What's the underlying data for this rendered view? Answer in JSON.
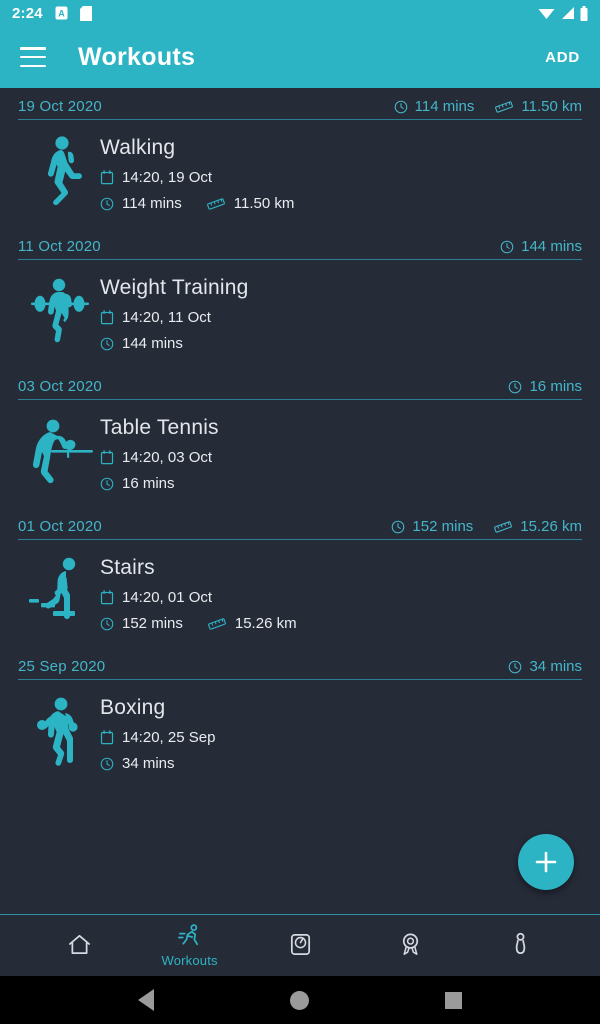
{
  "status_bar": {
    "time": "2:24",
    "left_icons": [
      "alert-badge-icon",
      "sdcard-icon"
    ],
    "right_icons": [
      "wifi-icon",
      "signal-icon",
      "battery-icon"
    ]
  },
  "app_bar": {
    "menu_icon": "hamburger-menu-icon",
    "title": "Workouts",
    "action_label": "ADD"
  },
  "colors": {
    "accent": "#2cb4c4",
    "background": "#262b38",
    "text_primary": "#e3e6ea",
    "text_accent": "#43b6c8"
  },
  "groups": [
    {
      "date": "19 Oct 2020",
      "total_duration": "114 mins",
      "total_distance": "11.50 km",
      "workout": {
        "icon": "walking-person-icon",
        "name": "Walking",
        "datetime": "14:20, 19 Oct",
        "duration": "114 mins",
        "distance": "11.50 km"
      }
    },
    {
      "date": "11 Oct 2020",
      "total_duration": "144 mins",
      "total_distance": "",
      "workout": {
        "icon": "weightlifter-icon",
        "name": "Weight Training",
        "datetime": "14:20, 11 Oct",
        "duration": "144 mins",
        "distance": ""
      }
    },
    {
      "date": "03 Oct 2020",
      "total_duration": "16 mins",
      "total_distance": "",
      "workout": {
        "icon": "table-tennis-icon",
        "name": "Table Tennis",
        "datetime": "14:20, 03 Oct",
        "duration": "16 mins",
        "distance": ""
      }
    },
    {
      "date": "01 Oct 2020",
      "total_duration": "152 mins",
      "total_distance": "15.26 km",
      "workout": {
        "icon": "stairs-climber-icon",
        "name": "Stairs",
        "datetime": "14:20, 01 Oct",
        "duration": "152 mins",
        "distance": "15.26 km"
      }
    },
    {
      "date": "25 Sep 2020",
      "total_duration": "34 mins",
      "total_distance": "",
      "workout": {
        "icon": "boxer-icon",
        "name": "Boxing",
        "datetime": "14:20, 25 Sep",
        "duration": "34 mins",
        "distance": ""
      }
    }
  ],
  "fab": {
    "icon": "plus-icon",
    "label": "+"
  },
  "bottom_nav": {
    "items": [
      {
        "icon": "home-icon",
        "label": "",
        "active": false
      },
      {
        "icon": "running-person-icon",
        "label": "Workouts",
        "active": true
      },
      {
        "icon": "weight-scale-icon",
        "label": "",
        "active": false
      },
      {
        "icon": "medal-award-icon",
        "label": "",
        "active": false
      },
      {
        "icon": "profile-person-icon",
        "label": "",
        "active": false
      }
    ]
  },
  "system_nav": {
    "back": "back-triangle-icon",
    "home": "home-circle-icon",
    "recents": "recents-square-icon"
  }
}
